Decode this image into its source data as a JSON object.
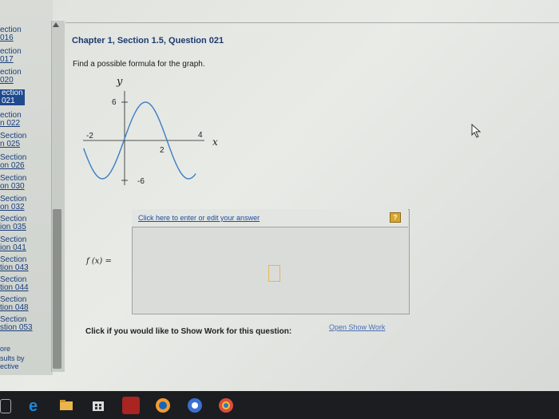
{
  "sidebar": {
    "items": [
      {
        "a": "ection",
        "b": "016"
      },
      {
        "a": "ection",
        "b": "017"
      },
      {
        "a": "ection",
        "b": "020"
      },
      {
        "a": "ection",
        "b": "021",
        "active": true
      },
      {
        "a": "ection",
        "b": "n 022"
      },
      {
        "a": "Section",
        "b": "n 025"
      },
      {
        "a": "Section",
        "b": "on 026"
      },
      {
        "a": "Section",
        "b": "on 030"
      },
      {
        "a": "Section",
        "b": "on 032"
      },
      {
        "a": "Section",
        "b": "ion 035"
      },
      {
        "a": "Section",
        "b": "ion 041"
      },
      {
        "a": "Section",
        "b": "tion 043"
      },
      {
        "a": "Section",
        "b": "tion 044"
      },
      {
        "a": "Section",
        "b": "tion 048"
      },
      {
        "a": "Section",
        "b": "stion 053"
      }
    ],
    "more": "ore",
    "results_by": "sults by",
    "results_by2": "ective"
  },
  "question": {
    "title": "Chapter 1, Section 1.5, Question 021",
    "prompt": "Find a possible formula for the graph."
  },
  "graph": {
    "y_axis_label": "y",
    "x_axis_label": "x",
    "y_top_label": "6",
    "y_bottom_label": "-6",
    "x_left_label": "-2",
    "x_mid_label": "2",
    "x_right_label": "4",
    "stroke": "#3b7ec4"
  },
  "answer": {
    "link_text": "Click here to enter or edit your answer",
    "fx_label": "f (x) =",
    "help_icon": "?"
  },
  "show_work": {
    "text": "Click if you would like to Show Work for this question:",
    "link": "Open Show Work"
  },
  "taskbar": {
    "items": [
      "search-icon",
      "edge-icon",
      "store-icon",
      "app-icon",
      "media-icon",
      "chrome-icon",
      "chrome-icon"
    ]
  }
}
